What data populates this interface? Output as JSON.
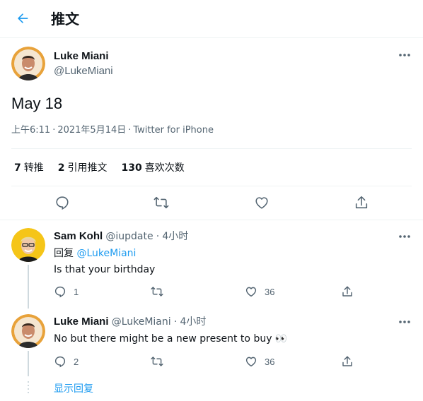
{
  "header": {
    "title": "推文"
  },
  "colors": {
    "accent": "#1d9bf0",
    "secondary_text": "#536471"
  },
  "tweet": {
    "author_name": "Luke Miani",
    "author_handle": "@LukeMiani",
    "text": "May 18",
    "time": "上午6:11",
    "date": "2021年5月14日",
    "source": "Twitter for iPhone",
    "separator": "·",
    "stats": {
      "retweets": "7",
      "retweets_label": "转推",
      "quotes": "2",
      "quotes_label": "引用推文",
      "likes": "130",
      "likes_label": "喜欢次数"
    }
  },
  "replies": [
    {
      "author_name": "Sam Kohl",
      "author_handle": "@iupdate",
      "time_ago": "4小时",
      "separator": "·",
      "reply_prefix": "回复",
      "reply_to": "@LukeMiani",
      "text": "Is that your birthday",
      "reply_count": "1",
      "retweet_count": "",
      "like_count": "36"
    },
    {
      "author_name": "Luke Miani",
      "author_handle": "@LukeMiani",
      "time_ago": "4小时",
      "separator": "·",
      "text": "No but there might be a new present to buy 👀",
      "reply_count": "2",
      "retweet_count": "",
      "like_count": "36"
    }
  ],
  "show_replies_label": "显示回复",
  "icons": [
    "back-arrow-icon",
    "more-icon",
    "reply-icon",
    "retweet-icon",
    "like-icon",
    "share-icon"
  ]
}
